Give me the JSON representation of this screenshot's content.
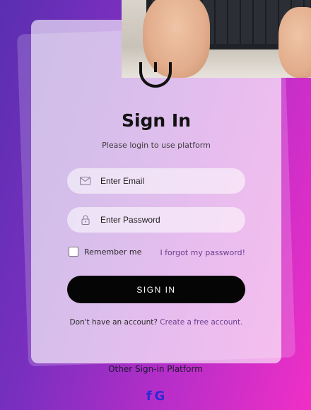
{
  "signin": {
    "title": "Sign In",
    "subtitle": "Please login to use platform",
    "email_placeholder": "Enter Email",
    "password_placeholder": "Enter Password",
    "remember_label": "Remember me",
    "forgot_link": "I forgot my password!",
    "button_label": "SIGN IN",
    "no_account_text": "Don't have an account?",
    "create_link": "Create a free account."
  },
  "footer": {
    "other_platform_label": "Other Sign-in Platform",
    "facebook_glyph": "f",
    "google_glyph": "G"
  },
  "icons": {
    "email": "mail-icon",
    "password": "lock-icon",
    "logo": "logo-icon"
  },
  "colors": {
    "accent_link": "#6a3f8f",
    "button": "#050505",
    "social": "#2a2ad6"
  }
}
